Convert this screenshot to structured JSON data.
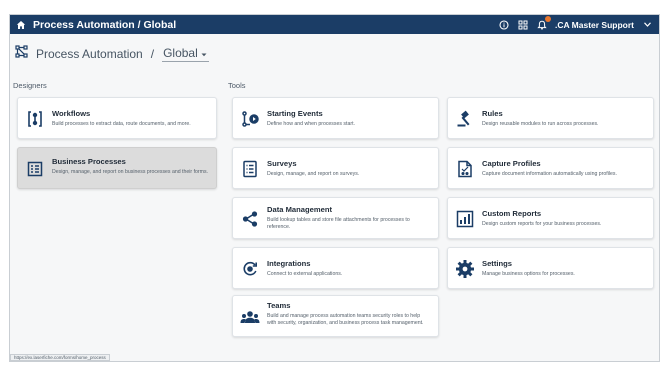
{
  "topbar": {
    "title": "Process Automation  / Global",
    "user": ".CA Master Support"
  },
  "breadcrumb": {
    "app": "Process Automation",
    "separator": "/",
    "scope": "Global"
  },
  "sections": {
    "designers": "Designers",
    "tools": "Tools"
  },
  "designers": [
    {
      "title": "Workflows",
      "desc": "Build processes to extract data, route documents, and more."
    },
    {
      "title": "Business Processes",
      "desc": "Design, manage, and report on business processes and their forms."
    }
  ],
  "tools": [
    {
      "title": "Starting Events",
      "desc": "Define how and when processes start."
    },
    {
      "title": "Rules",
      "desc": "Design reusable modules to run across processes."
    },
    {
      "title": "Surveys",
      "desc": "Design, manage, and report on surveys."
    },
    {
      "title": "Capture Profiles",
      "desc": "Capture document information automatically using profiles."
    },
    {
      "title": "Data Management",
      "desc": "Build lookup tables and store file attachments for processes to reference."
    },
    {
      "title": "Custom Reports",
      "desc": "Design custom reports for your business processes."
    },
    {
      "title": "Integrations",
      "desc": "Connect to external applications."
    },
    {
      "title": "Settings",
      "desc": "Manage business options for processes."
    },
    {
      "title": "Teams",
      "desc": "Build and manage process automation teams security roles to help with security, organization, and business process task management."
    }
  ],
  "status_url": "https://ex.laserfiche.com/forms/home_process",
  "colors": {
    "header": "#1b3d66",
    "icon": "#1b3d66",
    "selected_card": "#dcdcdc",
    "notification_badge": "#e8772e"
  },
  "icons": {
    "home": "home-icon",
    "help": "help-icon",
    "apps": "apps-grid-icon",
    "notifications": "bell-icon",
    "user_menu": "chevron-down-icon",
    "breadcrumb": "process-automation-icon",
    "scope_select": "chevron-down-icon",
    "designers": [
      "workflow-icon",
      "business-process-icon"
    ],
    "tools": [
      "starting-events-icon",
      "rules-gavel-icon",
      "surveys-icon",
      "capture-profiles-icon",
      "data-management-icon",
      "custom-reports-icon",
      "integrations-icon",
      "settings-gear-icon",
      "teams-icon"
    ]
  }
}
